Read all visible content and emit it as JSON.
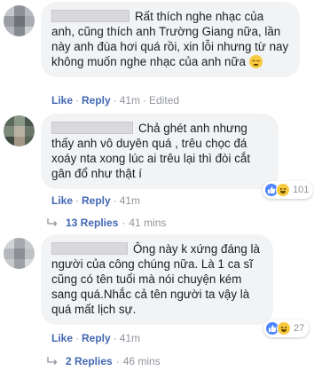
{
  "comments": [
    {
      "text": "Rất thích nghe nhạc của anh, cũng thích anh Trường Giang nữa, lần này anh đùa hơi quá rồi, xin lỗi nhưng từ nay không muốn nghe nhạc của anh nữa",
      "like_label": "Like",
      "reply_label": "Reply",
      "time": "41m",
      "edited_label": "Edited"
    },
    {
      "text": "Chả ghét anh nhưng thấy anh vô duyên quá , trêu chọc đá xoáy nta xong lúc ai trêu lại thì đòi cắt gân đổ như thật í",
      "like_label": "Like",
      "reply_label": "Reply",
      "time": "41m",
      "reaction_count": "101",
      "replies_label": "13 Replies",
      "replies_time": "41 mins"
    },
    {
      "text": "Ông này k xứng đáng là người của công chúng nữa. Là 1 ca sĩ cũng có tên tuổi mà nói chuyện kém sang quá.Nhắc cả tên người ta vậy là quá mất lịch sự.",
      "like_label": "Like",
      "reply_label": "Reply",
      "time": "41m",
      "reaction_count": "27",
      "replies_label": "2 Replies",
      "replies_time": "46 mins"
    }
  ],
  "separator": "·",
  "colors": {
    "link": "#4267b2",
    "meta": "#90949c",
    "bubble": "#f2f3f5",
    "like_reaction": "#4f84ff",
    "haha_reaction": "#f7c93f"
  },
  "icons": {
    "inline_emoji": "relieved-face-emoji-icon",
    "reaction_1": "like-reaction-icon",
    "reaction_2": "haha-reaction-icon",
    "replies_arrow": "reply-arrow-icon"
  }
}
